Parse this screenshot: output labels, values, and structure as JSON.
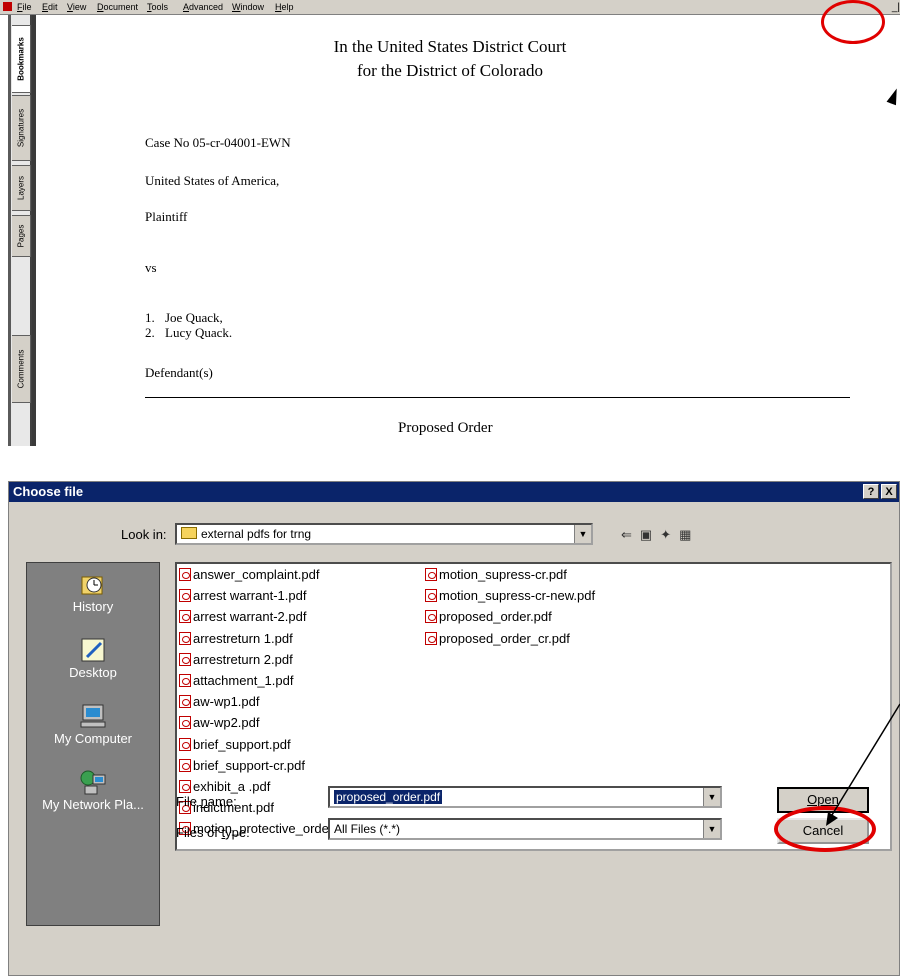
{
  "acrobat": {
    "menu": [
      "File",
      "Edit",
      "View",
      "Document",
      "Tools",
      "Advanced",
      "Window",
      "Help"
    ],
    "side_tabs": [
      "Bookmarks",
      "Signatures",
      "Layers",
      "Pages",
      "Comments"
    ],
    "document": {
      "title_line1": "In the United States District Court",
      "title_line2": "for the District of Colorado",
      "case_no": "Case No 05-cr-04001-EWN",
      "party1": "United States of America,",
      "party1_role": "Plaintiff",
      "versus": "vs",
      "defendants": [
        {
          "num": "1.",
          "name": "Joe Quack,"
        },
        {
          "num": "2.",
          "name": "Lucy Quack."
        }
      ],
      "defendants_role": "Defendant(s)",
      "order_title": "Proposed Order"
    }
  },
  "dialog": {
    "title": "Choose file",
    "help_btn": "?",
    "close_btn": "X",
    "look_in_label": "Look in:",
    "look_in_value": "external  pdfs for trng",
    "places": [
      "History",
      "Desktop",
      "My Computer",
      "My Network Pla..."
    ],
    "files_col1": [
      "answer_complaint.pdf",
      "arrest warrant-1.pdf",
      "arrest warrant-2.pdf",
      "arrestreturn 1.pdf",
      "arrestreturn 2.pdf",
      "attachment_1.pdf",
      "aw-wp1.pdf",
      "aw-wp2.pdf",
      "brief_support.pdf",
      "brief_support-cr.pdf",
      "exhibit_a .pdf",
      "indictment.pdf",
      "motion_protective_order.pdf"
    ],
    "files_col2": [
      "motion_supress-cr.pdf",
      "motion_supress-cr-new.pdf",
      "proposed_order.pdf",
      "proposed_order_cr.pdf"
    ],
    "file_name_label": "File name:",
    "file_name_value": "proposed_order.pdf",
    "files_of_type_label": "Files of type:",
    "files_of_type_value": "All Files (*.*)",
    "open_button": "Open",
    "cancel_button": "Cancel"
  },
  "colors": {
    "titlebar": "#0a246a",
    "annotation_red": "#e00000",
    "dialog_face": "#d4d0c8",
    "places_bg": "#808080"
  }
}
